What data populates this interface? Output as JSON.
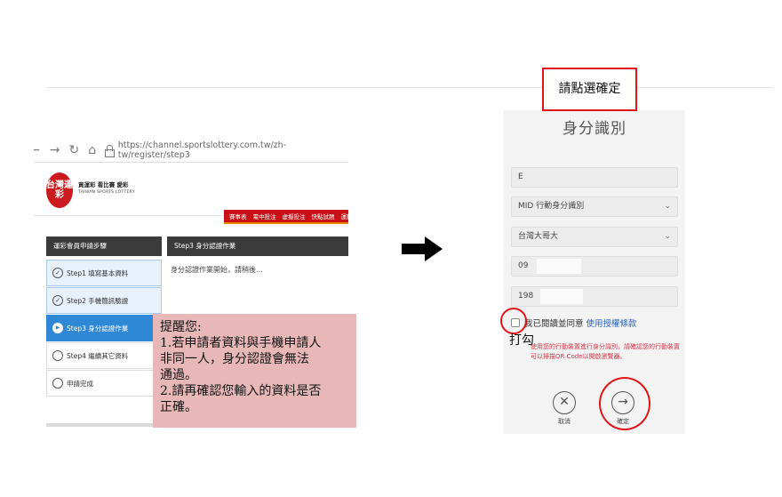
{
  "browser": {
    "url": "https://channel.sportslottery.com.tw/zh-tw/register/step3",
    "brand": {
      "logo_text": "台灣運彩",
      "nav_text": "買運彩  看比賽  愛彩",
      "sub_text": "TAIWAN SPORTS LOTTERY"
    },
    "red_menu": [
      "賽事表",
      "電中投注",
      "虛擬投注",
      "快點試題",
      "運動數據"
    ],
    "steps_header": "運彩會員申請步驟",
    "steps": [
      {
        "label": "Step1 填寫基本資料",
        "state": "done"
      },
      {
        "label": "Step2 手機簡訊驗證",
        "state": "done"
      },
      {
        "label": "Step3 身分認證作業",
        "state": "active"
      },
      {
        "label": "Step4 繼續其它資料",
        "state": "todo"
      },
      {
        "label": "申請完成",
        "state": "todo"
      }
    ],
    "content_header": "Step3 身分認證作業",
    "content_text": "身分認證作業開始，請稍後..."
  },
  "note": {
    "lines": [
      "提醒您:",
      "1.若申請者資料與手機申請人",
      "非同一人，身分認證會無法",
      "通過。",
      "2.請再確認您輸入的資料是否",
      "正確。"
    ]
  },
  "annotations": {
    "callout": "請點選確定",
    "tick_label": "打勾"
  },
  "phone": {
    "title": "身分識別",
    "field_id": "E",
    "id_type": "MID 行動身分識別",
    "carrier": "台灣大哥大",
    "phone_number": "09",
    "birth": "198",
    "consent_text": "我已閱讀並同意",
    "consent_link": "使用授權條款",
    "warning": "使用您的行動裝置進行身分識別，請確認您的行動裝置可以掃描QR Code以開啟瀏覽器。",
    "cancel_label": "取消",
    "confirm_label": "確定"
  },
  "colors": {
    "accent_red": "#e0151a",
    "active_step": "#2f88d5",
    "note_bg": "#e8b8b8"
  }
}
